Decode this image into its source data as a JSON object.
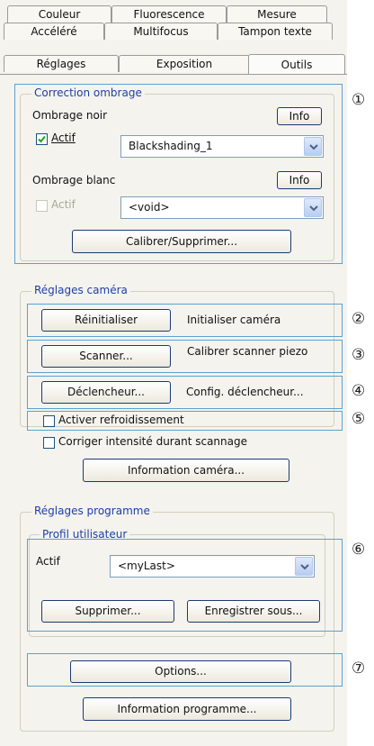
{
  "tabs": {
    "row1": [
      "Couleur",
      "Fluorescence",
      "Mesure"
    ],
    "row2": [
      "Accéléré",
      "Multifocus",
      "Tampon texte"
    ],
    "row3": [
      "Réglages",
      "Exposition",
      "Outils"
    ]
  },
  "shading": {
    "legend": "Correction ombrage",
    "black_label": "Ombrage noir",
    "info_label": "Info",
    "active_label": "Actif",
    "black_value": "Blackshading_1",
    "white_label": "Ombrage blanc",
    "white_value": "<void>",
    "calibrate_label": "Calibrer/Supprimer..."
  },
  "camera": {
    "legend": "Réglages caméra",
    "reset_label": "Réinitialiser",
    "reset_desc": "Initialiser caméra",
    "scanner_label": "Scanner...",
    "scanner_desc": "Calibrer scanner piezo",
    "trigger_label": "Déclencheur...",
    "trigger_desc": "Config. déclencheur...",
    "cooling_label": "Activer refroidissement",
    "intensity_label": "Corriger intensité durant scannage",
    "info_label": "Information caméra..."
  },
  "program": {
    "legend": "Réglages programme",
    "profile_legend": "Profil utilisateur",
    "active_label": "Actif",
    "profile_value": "<myLast>",
    "delete_label": "Supprimer...",
    "save_as_label": "Enregistrer sous...",
    "options_label": "Options...",
    "info_label": "Information programme..."
  },
  "callouts": [
    "①",
    "②",
    "③",
    "④",
    "⑤",
    "⑥",
    "⑦"
  ],
  "colors": {
    "frame": "#5aa2cf",
    "legend": "#1f3fa6",
    "button_border": "#1c3a74",
    "check": "#21a121"
  }
}
